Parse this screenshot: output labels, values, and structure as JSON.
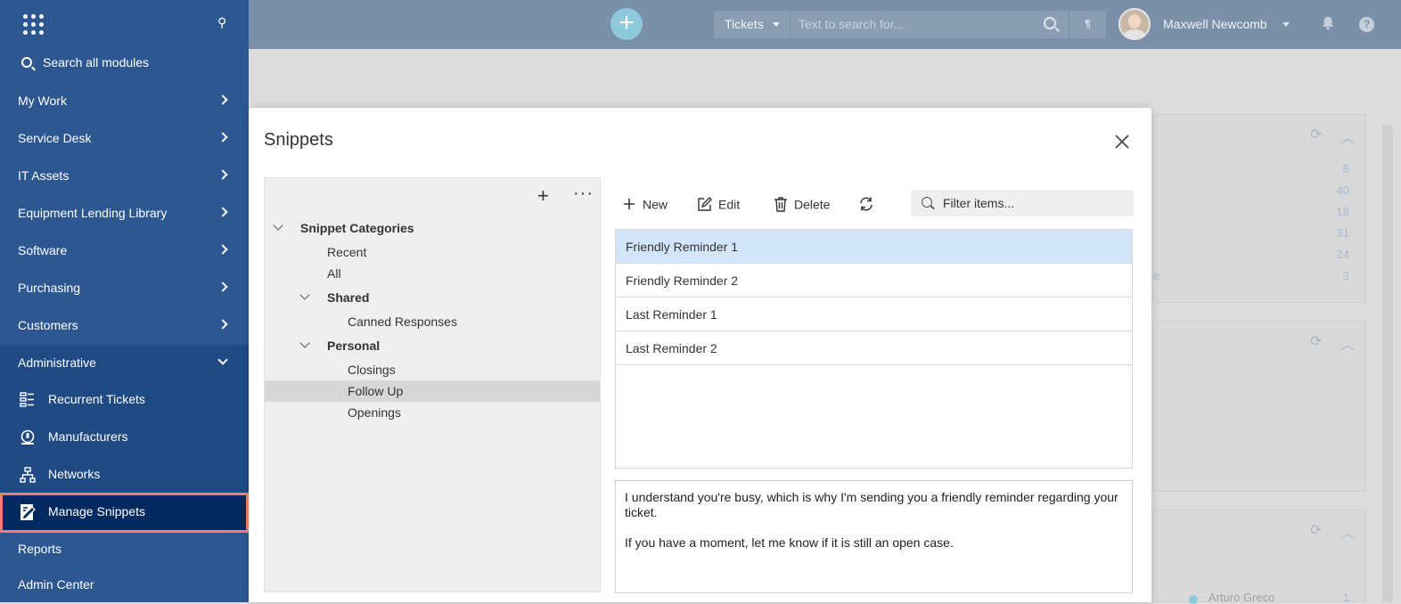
{
  "topbar": {
    "search_scope": "Tickets",
    "search_placeholder": "Text to search for...",
    "user_name": "Maxwell Newcomb"
  },
  "sidebar": {
    "search_label": "Search all modules",
    "items": [
      {
        "label": "My Work"
      },
      {
        "label": "Service Desk"
      },
      {
        "label": "IT Assets"
      },
      {
        "label": "Equipment Lending Library"
      },
      {
        "label": "Software"
      },
      {
        "label": "Purchasing"
      },
      {
        "label": "Customers"
      },
      {
        "label": "Administrative"
      }
    ],
    "sub_items": [
      {
        "label": "Recurrent Tickets",
        "icon": "recurrent-tickets-icon"
      },
      {
        "label": "Manufacturers",
        "icon": "manufacturers-icon"
      },
      {
        "label": "Networks",
        "icon": "networks-icon"
      }
    ],
    "active_item": {
      "label": "Manage Snippets",
      "icon": "manage-snippets-icon"
    },
    "bottom_items": [
      {
        "label": "Reports"
      },
      {
        "label": "Admin Center"
      }
    ]
  },
  "background": {
    "counts": [
      "8",
      "40",
      "18",
      "31",
      "24",
      "3"
    ],
    "fragment": "e",
    "bottom_name": "Arturo Greco",
    "bottom_count": "1"
  },
  "modal": {
    "title": "Snippets",
    "tree": {
      "root": "Snippet Categories",
      "recent": "Recent",
      "all": "All",
      "shared": "Shared",
      "canned_responses": "Canned Responses",
      "personal": "Personal",
      "closings": "Closings",
      "follow_up": "Follow Up",
      "openings": "Openings"
    },
    "toolbar": {
      "new_label": "New",
      "edit_label": "Edit",
      "delete_label": "Delete"
    },
    "filter_placeholder": "Filter items...",
    "snippets": [
      "Friendly Reminder 1",
      "Friendly Reminder 2",
      "Last Reminder 1",
      "Last Reminder 2"
    ],
    "preview": {
      "paragraph1": "I understand you're busy, which is why I'm sending you a friendly reminder regarding your ticket.",
      "paragraph2": "If you have a moment, let me know if it is still an open case."
    }
  },
  "colors": {
    "sidebar_bg": "#2d5791",
    "sidebar_active": "#022a5e",
    "active_outline": "#f47e72",
    "selected_row": "#d3e5f9",
    "topbar_bg": "#7a8fa8"
  }
}
